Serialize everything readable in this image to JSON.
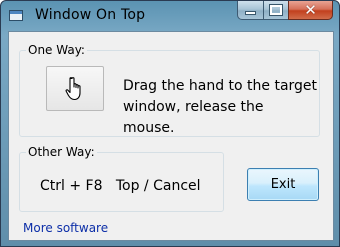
{
  "window": {
    "title": "Window On Top",
    "app_icon": "window-icon"
  },
  "caption_buttons": {
    "minimize": "minimize-icon",
    "maximize": "maximize-icon",
    "close": "close-icon",
    "close_glyph": "✕"
  },
  "one_way": {
    "legend": "One Way:",
    "hand_icon": "hand-pointer-icon",
    "instruction": "Drag the hand to the target window, release the mouse."
  },
  "other_way": {
    "legend": "Other Way:",
    "shortcut": "Ctrl + F8   Top / Cancel"
  },
  "exit_label": "Exit",
  "link_text": "More software",
  "colors": {
    "titlebar": "#6f9fbd",
    "client_bg": "#f0f0f0",
    "link": "#0d2fa8",
    "close_button": "#c7472a"
  }
}
